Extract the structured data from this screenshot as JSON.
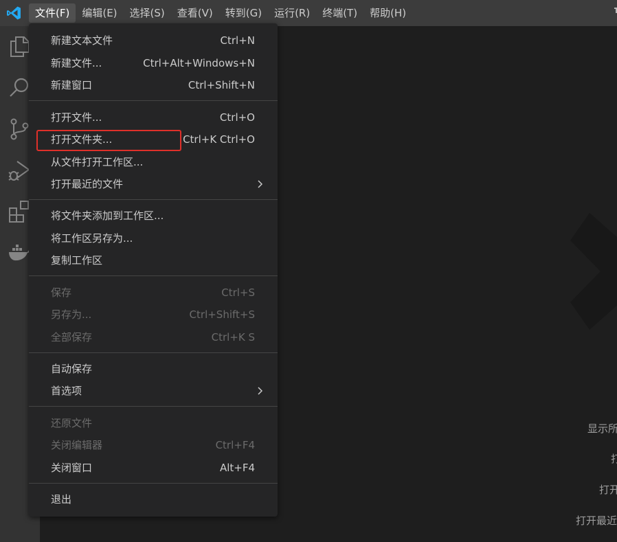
{
  "menubar": {
    "items": [
      "文件(F)",
      "编辑(E)",
      "选择(S)",
      "查看(V)",
      "转到(G)",
      "运行(R)",
      "终端(T)",
      "帮助(H)"
    ],
    "active_index": 0
  },
  "activity_bar": {
    "icons": [
      "files-icon",
      "search-icon",
      "source-control-icon",
      "run-debug-icon",
      "extensions-icon",
      "docker-icon"
    ]
  },
  "file_menu": {
    "items": [
      {
        "label": "新建文本文件",
        "shortcut": "Ctrl+N"
      },
      {
        "label": "新建文件...",
        "shortcut": "Ctrl+Alt+Windows+N"
      },
      {
        "label": "新建窗口",
        "shortcut": "Ctrl+Shift+N"
      },
      {
        "label": "打开文件...",
        "shortcut": "Ctrl+O"
      },
      {
        "label": "打开文件夹...",
        "shortcut": "Ctrl+K Ctrl+O"
      },
      {
        "label": "从文件打开工作区...",
        "shortcut": ""
      },
      {
        "label": "打开最近的文件",
        "shortcut": ""
      },
      {
        "label": "将文件夹添加到工作区...",
        "shortcut": ""
      },
      {
        "label": "将工作区另存为...",
        "shortcut": ""
      },
      {
        "label": "复制工作区",
        "shortcut": ""
      },
      {
        "label": "保存",
        "shortcut": "Ctrl+S"
      },
      {
        "label": "另存为...",
        "shortcut": "Ctrl+Shift+S"
      },
      {
        "label": "全部保存",
        "shortcut": "Ctrl+K S"
      },
      {
        "label": "自动保存",
        "shortcut": ""
      },
      {
        "label": "首选项",
        "shortcut": ""
      },
      {
        "label": "还原文件",
        "shortcut": ""
      },
      {
        "label": "关闭编辑器",
        "shortcut": "Ctrl+F4"
      },
      {
        "label": "关闭窗口",
        "shortcut": "Alt+F4"
      },
      {
        "label": "退出",
        "shortcut": ""
      }
    ]
  },
  "welcome": {
    "items": [
      "显示所",
      "打",
      "打开",
      "打开最近"
    ]
  },
  "colors": {
    "highlight_box": "#e0302a",
    "vscode_blue": "#23a9f2"
  }
}
